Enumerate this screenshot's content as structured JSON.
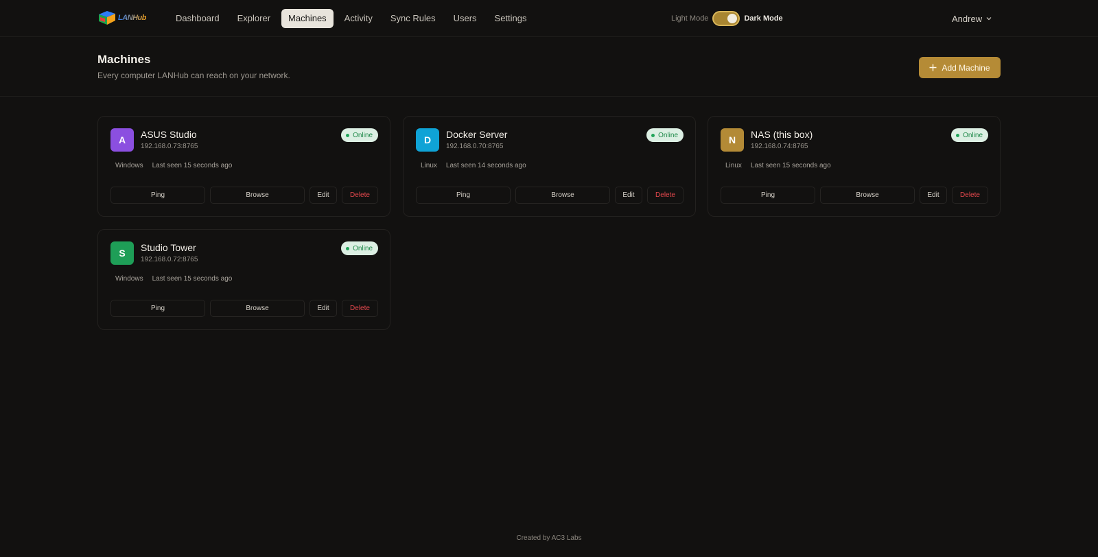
{
  "app": {
    "logo_text": "LANHub"
  },
  "nav": {
    "items": [
      {
        "label": "Dashboard"
      },
      {
        "label": "Explorer"
      },
      {
        "label": "Machines",
        "active": true
      },
      {
        "label": "Activity"
      },
      {
        "label": "Sync Rules"
      },
      {
        "label": "Users"
      },
      {
        "label": "Settings"
      }
    ]
  },
  "theme": {
    "light_label": "Light Mode",
    "dark_label": "Dark Mode",
    "mode": "dark"
  },
  "user": {
    "name": "Andrew"
  },
  "page": {
    "title": "Machines",
    "subtitle": "Every computer LANHub can reach on your network.",
    "add_button": "Add Machine"
  },
  "machines": [
    {
      "initial": "A",
      "avatar_color": "#8B4FE0",
      "name": "ASUS Studio",
      "address": "192.168.0.73:8765",
      "status": "Online",
      "os": "Windows",
      "last_seen": "Last seen 15 seconds ago",
      "actions": {
        "ping": "Ping",
        "browse": "Browse",
        "edit": "Edit",
        "delete": "Delete"
      }
    },
    {
      "initial": "D",
      "avatar_color": "#0FA3D6",
      "name": "Docker Server",
      "address": "192.168.0.70:8765",
      "status": "Online",
      "os": "Linux",
      "last_seen": "Last seen 14 seconds ago",
      "actions": {
        "ping": "Ping",
        "browse": "Browse",
        "edit": "Edit",
        "delete": "Delete"
      }
    },
    {
      "initial": "N",
      "avatar_color": "#B38A36",
      "name": "NAS (this box)",
      "address": "192.168.0.74:8765",
      "status": "Online",
      "os": "Linux",
      "last_seen": "Last seen 15 seconds ago",
      "actions": {
        "ping": "Ping",
        "browse": "Browse",
        "edit": "Edit",
        "delete": "Delete"
      }
    },
    {
      "initial": "S",
      "avatar_color": "#1E9E57",
      "name": "Studio Tower",
      "address": "192.168.0.72:8765",
      "status": "Online",
      "os": "Windows",
      "last_seen": "Last seen 15 seconds ago",
      "actions": {
        "ping": "Ping",
        "browse": "Browse",
        "edit": "Edit",
        "delete": "Delete"
      }
    }
  ],
  "footer": {
    "text": "Created by AC3 Labs"
  },
  "colors": {
    "background": "#121110",
    "accent": "#B58B36",
    "online": "#22A55A",
    "danger": "#E5484D"
  }
}
